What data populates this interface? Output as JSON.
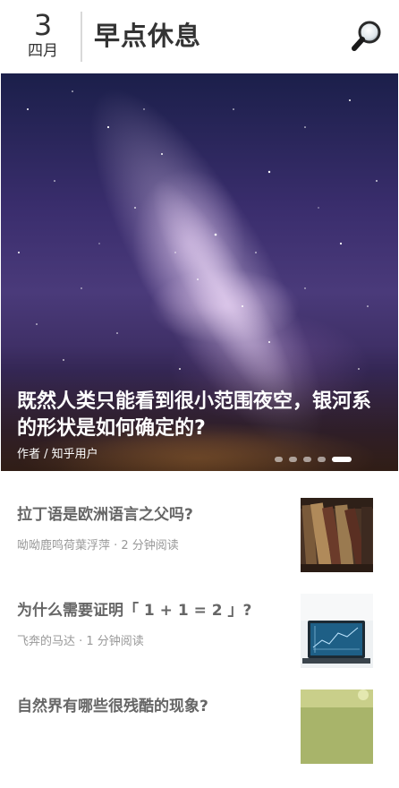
{
  "header": {
    "day": "3",
    "month": "四月",
    "app_title": "早点休息"
  },
  "hero": {
    "title": "既然人类只能看到很小范围夜空，银河系的形状是如何确定的?",
    "author": "作者 / 知乎用户",
    "slides_count": 5,
    "active_slide": 5
  },
  "stories": [
    {
      "title": "拉丁语是欧洲语言之父吗?",
      "meta": "呦呦鹿鸣荷葉浮萍 · 2 分钟阅读",
      "thumb": "old-books-image"
    },
    {
      "title": "为什么需要证明「 1 + 1 = 2 」?",
      "meta": "飞奔的马达 · 1 分钟阅读",
      "thumb": "laptop-math-image"
    },
    {
      "title": "自然界有哪些很残酷的现象?",
      "meta": "",
      "thumb": "nature-image"
    }
  ],
  "icons": {
    "search": "magnifier-icon"
  }
}
